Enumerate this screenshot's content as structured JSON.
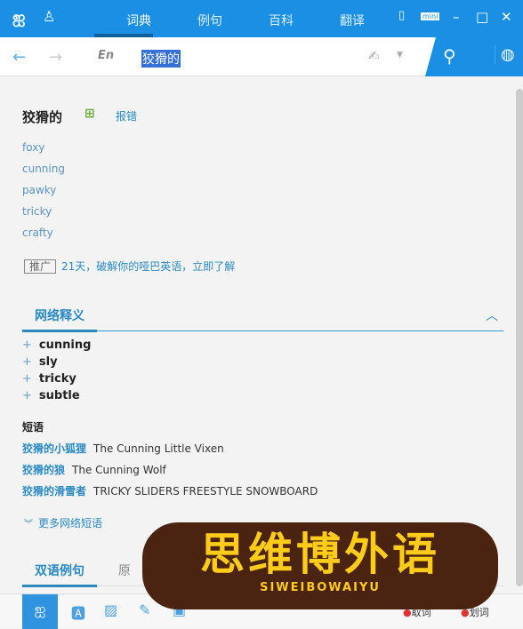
{
  "header": {
    "logo": "词",
    "tabs": [
      "词典",
      "例句",
      "百科",
      "翻译"
    ],
    "mini": "mini"
  },
  "search": {
    "lang": "En",
    "query": "狡猾的"
  },
  "entry": {
    "word": "狡猾的",
    "report": "报错",
    "translations": [
      "foxy",
      "cunning",
      "pawky",
      "tricky",
      "crafty"
    ]
  },
  "ad": {
    "tag": "推广",
    "text": "21天，破解你的哑巴英语，立即了解"
  },
  "web": {
    "title": "网络释义",
    "items": [
      "cunning",
      "sly",
      "tricky",
      "subtle"
    ],
    "phrases_title": "短语",
    "phrases": [
      {
        "cn": "狡猾的小狐狸",
        "en": "The Cunning Little Vixen"
      },
      {
        "cn": "狡猾的狼",
        "en": "The Cunning Wolf"
      },
      {
        "cn": "狡猾的滑雪者",
        "en": "TRICKY SLIDERS FREESTYLE SNOWBOARD"
      }
    ],
    "more": "更多网络短语"
  },
  "examples": {
    "tab1": "双语例句",
    "tab2": "原"
  },
  "footer": {
    "pick": "取词",
    "select": "划词"
  },
  "watermark": {
    "title": "思维博外语",
    "sub": "SIWEIBOWAIYU"
  },
  "colors": {
    "accent": "#1a8fe3"
  }
}
